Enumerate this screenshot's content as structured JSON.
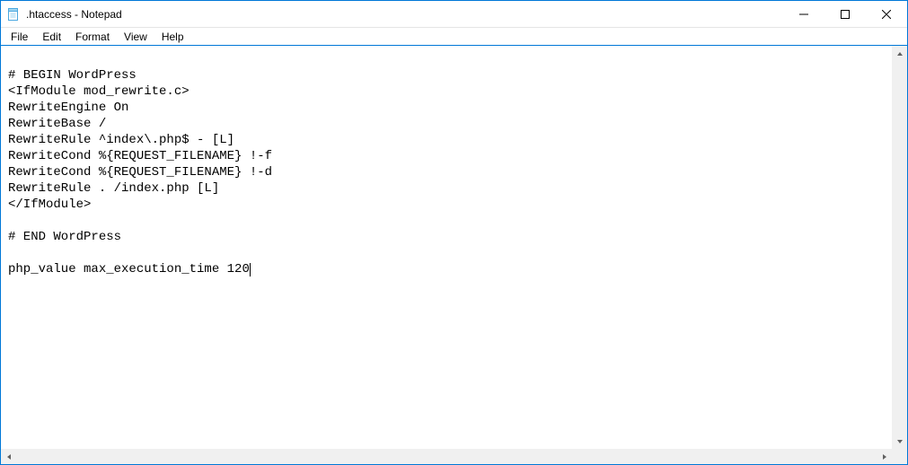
{
  "window": {
    "title": ".htaccess - Notepad"
  },
  "menu": {
    "file": "File",
    "edit": "Edit",
    "format": "Format",
    "view": "View",
    "help": "Help"
  },
  "editor": {
    "lines": [
      "",
      "# BEGIN WordPress",
      "<IfModule mod_rewrite.c>",
      "RewriteEngine On",
      "RewriteBase /",
      "RewriteRule ^index\\.php$ - [L]",
      "RewriteCond %{REQUEST_FILENAME} !-f",
      "RewriteCond %{REQUEST_FILENAME} !-d",
      "RewriteRule . /index.php [L]",
      "</IfModule>",
      "",
      "# END WordPress",
      "",
      "php_value max_execution_time 120"
    ],
    "caret_line": 13
  }
}
